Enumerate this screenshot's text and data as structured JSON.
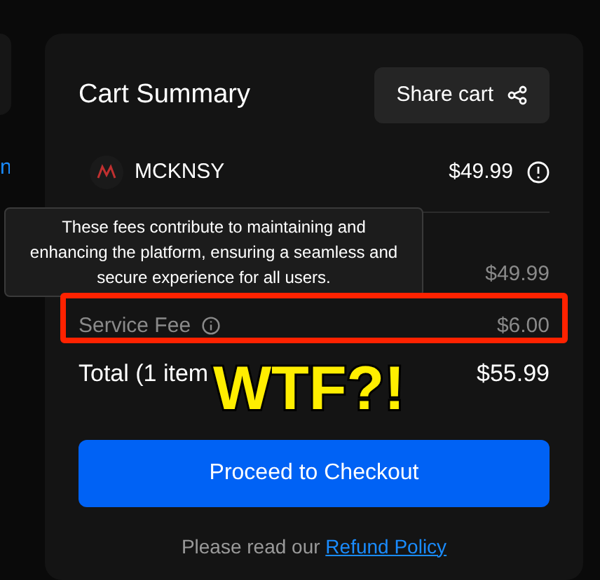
{
  "side_panel": {
    "link_text": "n"
  },
  "cart_summary": {
    "title": "Cart Summary",
    "share_button": "Share cart",
    "merchant": {
      "name": "MCKNSY",
      "price": "$49.99"
    },
    "tooltip": "These fees contribute to maintaining and enhancing the platform, ensuring a seamless and secure experience for all users.",
    "subtotal_amount": "$49.99",
    "service_fee": {
      "label": "Service Fee",
      "amount": "$6.00"
    },
    "total": {
      "label": "Total (1 item",
      "amount": "$55.99"
    },
    "checkout_button": "Proceed to Checkout",
    "refund_note": {
      "text": "Please read our",
      "link": "Refund Policy"
    }
  },
  "annotation": {
    "text": "WTF?!"
  }
}
